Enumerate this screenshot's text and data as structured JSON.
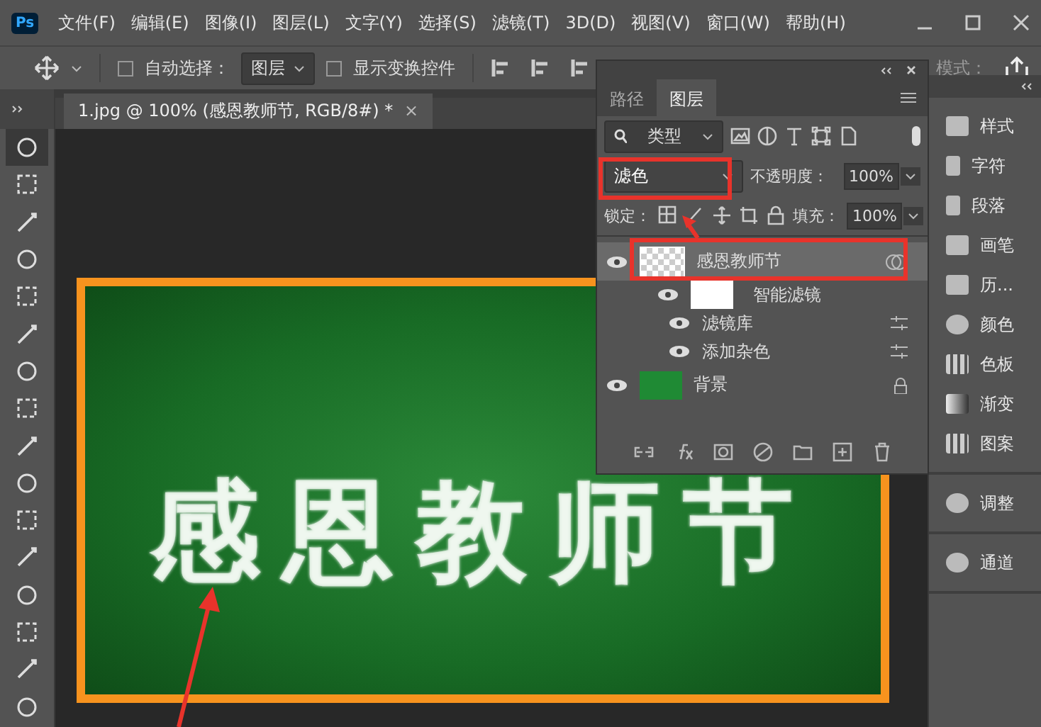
{
  "app": {
    "logo": "Ps"
  },
  "menu": [
    "文件(F)",
    "编辑(E)",
    "图像(I)",
    "图层(L)",
    "文字(Y)",
    "选择(S)",
    "滤镜(T)",
    "3D(D)",
    "视图(V)",
    "窗口(W)",
    "帮助(H)"
  ],
  "options_bar": {
    "auto_select": {
      "label": "自动选择：",
      "checked": false
    },
    "target": "图层",
    "transform_controls": {
      "label": "显示变换控件",
      "checked": false
    },
    "mode_label": "模式："
  },
  "document_tab": {
    "title": "1.jpg @ 100% (感恩教师节, RGB/8#) *",
    "close": "×"
  },
  "canvas": {
    "text": "感恩教师节"
  },
  "layers_panel": {
    "tabs": [
      {
        "label": "路径",
        "selected": false
      },
      {
        "label": "图层",
        "selected": true
      }
    ],
    "filter": "类型",
    "blend_mode": "滤色",
    "opacity_label": "不透明度：",
    "opacity": "100%",
    "lock_label": "锁定：",
    "fill_label": "填充：",
    "fill": "100%",
    "layers": [
      {
        "name": "感恩教师节",
        "kind": "smart",
        "selected": true,
        "visible": true,
        "children": [
          {
            "name": "智能滤镜",
            "kind": "mask",
            "visible": true,
            "children": [
              {
                "name": "滤镜库",
                "kind": "filter",
                "visible": true
              },
              {
                "name": "添加杂色",
                "kind": "filter",
                "visible": true
              }
            ]
          }
        ]
      },
      {
        "name": "背景",
        "kind": "background",
        "selected": false,
        "visible": true,
        "locked": true
      }
    ]
  },
  "dock_groups": [
    [
      {
        "label": "样式",
        "kind": "styles"
      },
      {
        "label": "字符",
        "kind": "character"
      },
      {
        "label": "段落",
        "kind": "paragraph"
      },
      {
        "label": "画笔",
        "kind": "brush"
      },
      {
        "label": "历...",
        "kind": "history"
      },
      {
        "label": "颜色",
        "kind": "color"
      },
      {
        "label": "色板",
        "kind": "swatches"
      },
      {
        "label": "渐变",
        "kind": "gradient"
      },
      {
        "label": "图案",
        "kind": "pattern"
      }
    ],
    [
      {
        "label": "调整",
        "kind": "adjust"
      }
    ],
    [
      {
        "label": "通道",
        "kind": "channels"
      }
    ]
  ]
}
